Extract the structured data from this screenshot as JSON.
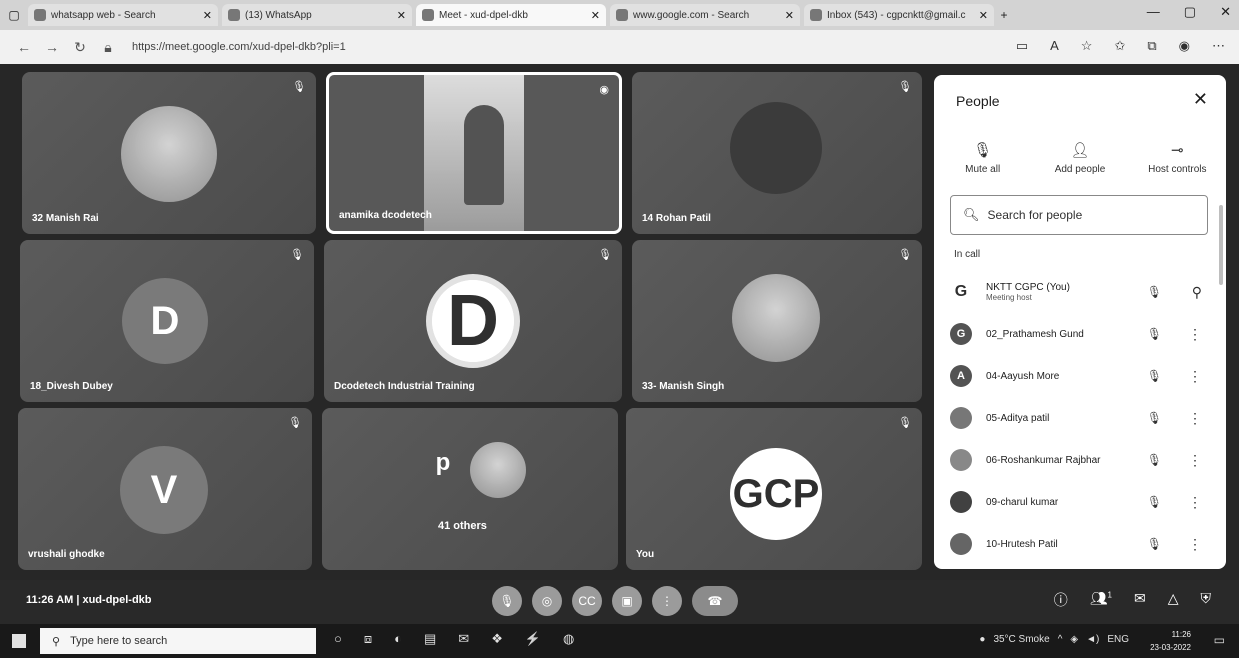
{
  "browser": {
    "tabs": [
      {
        "title": "whatsapp web - Search",
        "active": false
      },
      {
        "title": "(13) WhatsApp",
        "active": false
      },
      {
        "title": "Meet - xud-dpel-dkb",
        "active": true
      },
      {
        "title": "www.google.com - Search",
        "active": false
      },
      {
        "title": "Inbox (543) - cgpcnktt@gmail.c",
        "active": false
      }
    ],
    "new_tab": "+",
    "url": "https://meet.google.com/xud-dpel-dkb?pli=1"
  },
  "tiles": [
    {
      "name": "32 Manish Rai",
      "avatar": "photo"
    },
    {
      "name": "anamika dcodetech",
      "avatar": "presenting"
    },
    {
      "name": "14 Rohan Patil",
      "avatar": "dark"
    },
    {
      "name": "18_Divesh Dubey",
      "avatar": "D"
    },
    {
      "name": "Dcodetech Industrial Training",
      "avatar": "D"
    },
    {
      "name": "33- Manish Singh",
      "avatar": "photo"
    },
    {
      "name": "vrushali ghodke",
      "avatar": "V"
    },
    {
      "name": "41 others",
      "avatar": "p"
    },
    {
      "name": "You",
      "avatar": "GCP"
    }
  ],
  "panel": {
    "title": "People",
    "actions": [
      "Mute all",
      "Add people",
      "Host controls"
    ],
    "search_placeholder": "Search for people",
    "section": "In call",
    "people": [
      {
        "name": "NKTT CGPC (You)",
        "sub": "Meeting host",
        "initial": "G"
      },
      {
        "name": "02_Prathamesh Gund",
        "sub": "",
        "initial": "G"
      },
      {
        "name": "04-Aayush More",
        "sub": "",
        "initial": "A"
      },
      {
        "name": "05-Aditya patil",
        "sub": "",
        "initial": ""
      },
      {
        "name": "06-Roshankumar Rajbhar",
        "sub": "",
        "initial": ""
      },
      {
        "name": "09-charul kumar",
        "sub": "",
        "initial": ""
      },
      {
        "name": "10-Hrutesh Patil",
        "sub": "",
        "initial": ""
      }
    ]
  },
  "controls": {
    "meeting_info": "11:26 AM | xud-dpel-dkb",
    "participants_badge": "1"
  },
  "taskbar": {
    "search_placeholder": "Type here to search",
    "weather": "35°C Smoke",
    "lang": "ENG",
    "time": "11:26",
    "date": "23-03-2022"
  }
}
